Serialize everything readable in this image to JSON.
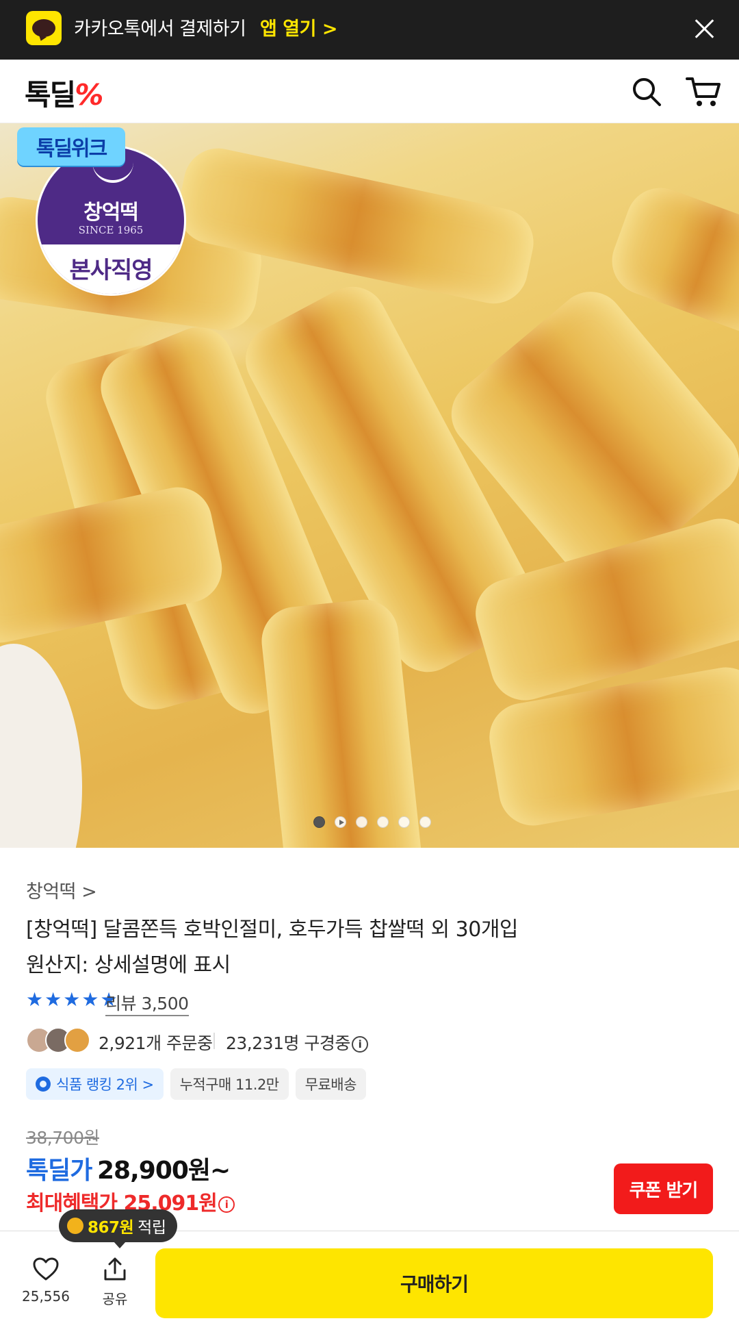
{
  "banner": {
    "text": "카카오톡에서 결제하기",
    "open_label": "앱 열기 >"
  },
  "header": {
    "logo_main": "톡딜",
    "logo_mark": "%"
  },
  "hero": {
    "badge_week": "톡딜위크",
    "badge_brand": "창억떡",
    "badge_since": "SINCE 1965",
    "badge_direct": "본사직영",
    "slide_count": 6,
    "active_slide": 1
  },
  "product": {
    "brand_link": "창억떡 >",
    "title": "[창억떡] 달콤쫀득 호박인절미, 호두가득 찹쌀떡 외 30개입",
    "origin": "원산지: 상세설명에 표시",
    "rating_stars": 5,
    "review_label": "리뷰 3,500",
    "orders": "2,921개 주문중",
    "watching": "23,231명 구경중",
    "chips": [
      {
        "label": "식품 랭킹 2위 >",
        "style": "blue"
      },
      {
        "label": "누적구매 11.2만",
        "style": "gray"
      },
      {
        "label": "무료배송",
        "style": "gray"
      }
    ]
  },
  "price": {
    "original": "38,700원",
    "deal_label": "톡딜가",
    "deal_price": "28,900원~",
    "max_benefit": "최대혜택가 25,091원",
    "coupon_button": "쿠폰 받기"
  },
  "bottom": {
    "like_count": "25,556",
    "share_label": "공유",
    "buy_label": "구매하기",
    "points_amount": "867원",
    "points_suffix": "적립"
  },
  "colors": {
    "kakao_yellow": "#fee500",
    "deal_blue": "#1f6be0",
    "benefit_red": "#ee2a2a",
    "brand_purple": "#4e2a86"
  }
}
